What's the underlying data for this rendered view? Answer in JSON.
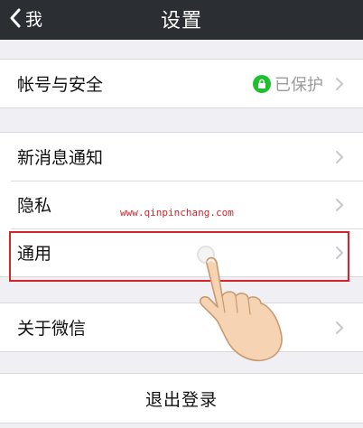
{
  "navbar": {
    "back_label": "我",
    "title": "设置"
  },
  "account": {
    "label": "帐号与安全",
    "status_text": "已保护",
    "status_icon": "lock-icon",
    "status_color": "#1fbf2f"
  },
  "groups": {
    "notifications": "新消息通知",
    "privacy": "隐私",
    "general": "通用",
    "about": "关于微信"
  },
  "logout_label": "退出登录",
  "overlay": {
    "watermark": "www.qinpinchang.com",
    "highlight_color": "#d4232b"
  }
}
